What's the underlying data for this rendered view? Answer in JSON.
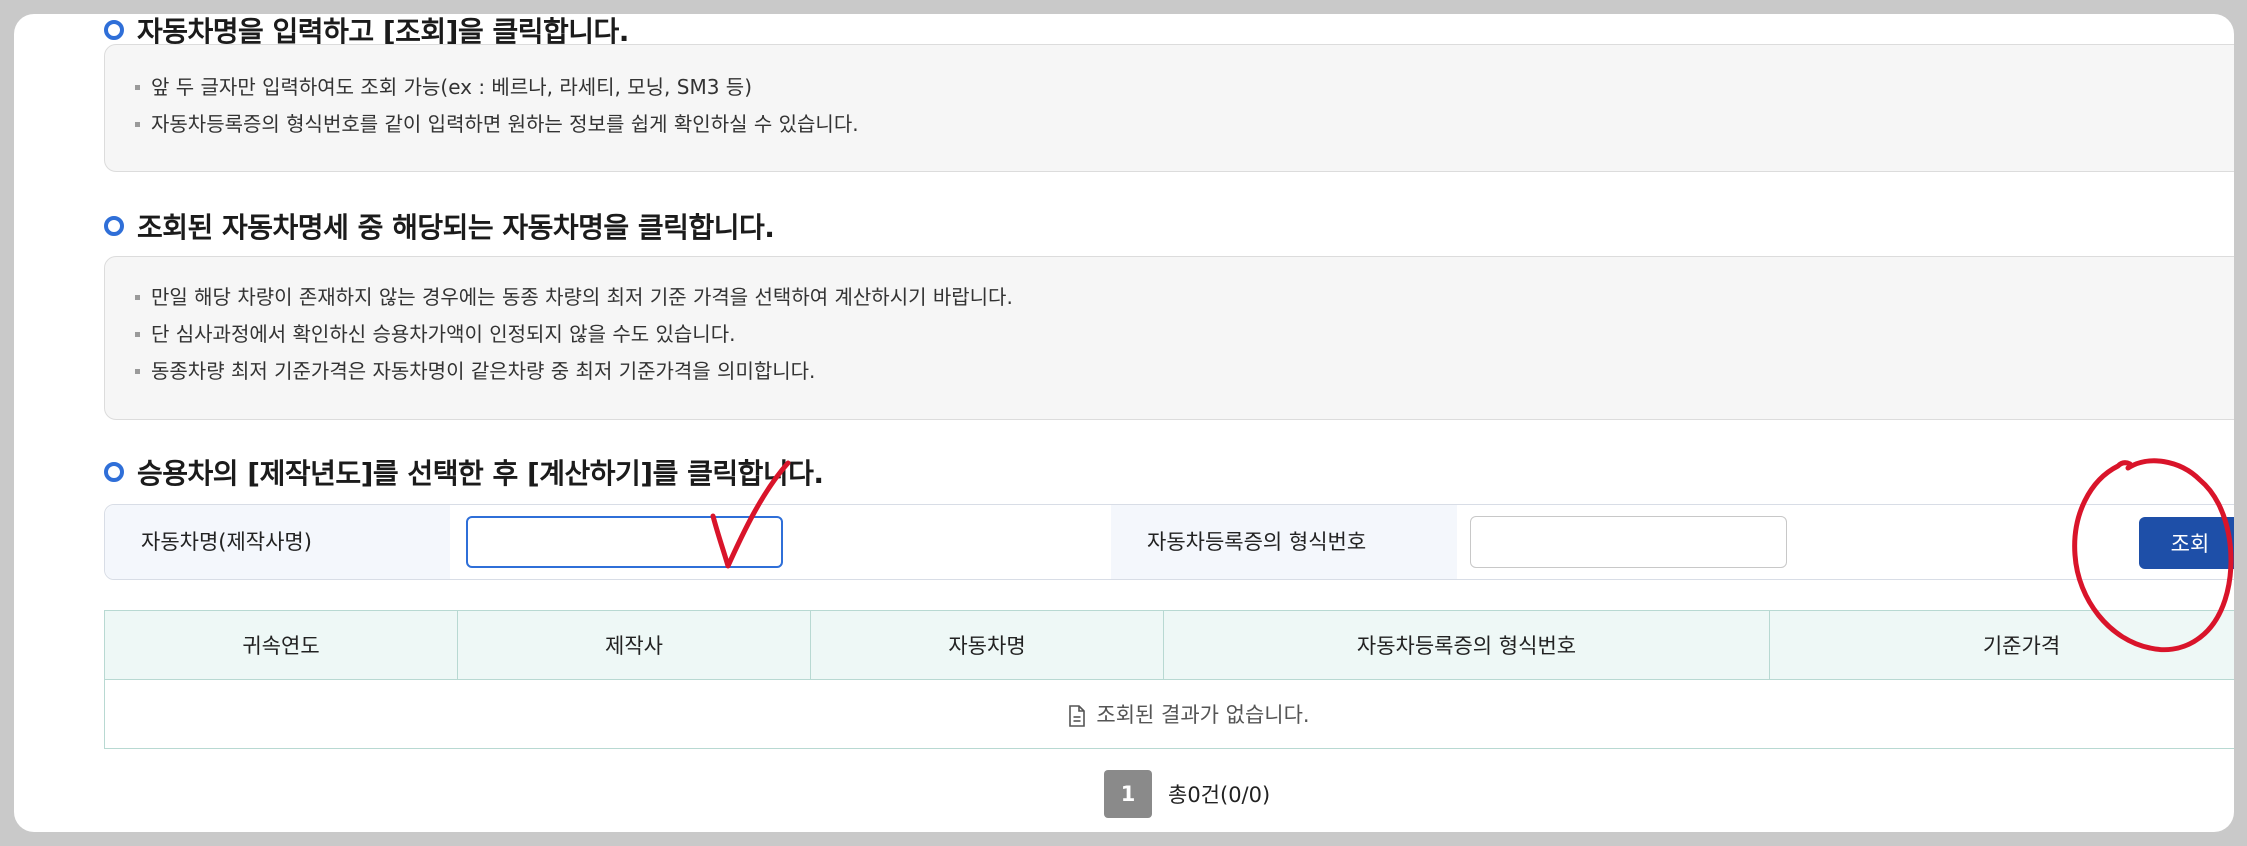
{
  "steps": [
    {
      "title": "자동차명을 입력하고 [조회]을 클릭합니다.",
      "notes": [
        "앞 두 글자만 입력하여도 조회 가능(ex : 베르나, 라세티, 모닝, SM3 등)",
        "자동차등록증의 형식번호를 같이 입력하면 원하는 정보를 쉽게 확인하실 수 있습니다."
      ]
    },
    {
      "title": "조회된 자동차명세 중 해당되는 자동차명을 클릭합니다.",
      "notes": [
        "만일 해당 차량이 존재하지 않는 경우에는 동종 차량의 최저 기준 가격을 선택하여 계산하시기 바랍니다.",
        "단 심사과정에서 확인하신 승용차가액이 인정되지 않을 수도 있습니다.",
        "동종차량 최저 기준가격은 자동차명이 같은차량 중  최저 기준가격을 의미합니다."
      ]
    },
    {
      "title": "승용차의 [제작년도]를 선택한 후 [계산하기]를 클릭합니다."
    }
  ],
  "search": {
    "car_name_label": "자동차명(제작사명)",
    "car_name_value": "",
    "type_number_label": "자동차등록증의 형식번호",
    "type_number_value": "",
    "button_label": "조회"
  },
  "table": {
    "columns": [
      "귀속연도",
      "제작사",
      "자동차명",
      "자동차등록증의 형식번호",
      "기준가격"
    ],
    "empty_message": "조회된 결과가 없습니다."
  },
  "pagination": {
    "current_page": "1",
    "total_text": "총0건(0/0)"
  },
  "colors": {
    "accent": "#2f6fd8",
    "button": "#1e4fa8",
    "annotation": "#d9142a"
  }
}
